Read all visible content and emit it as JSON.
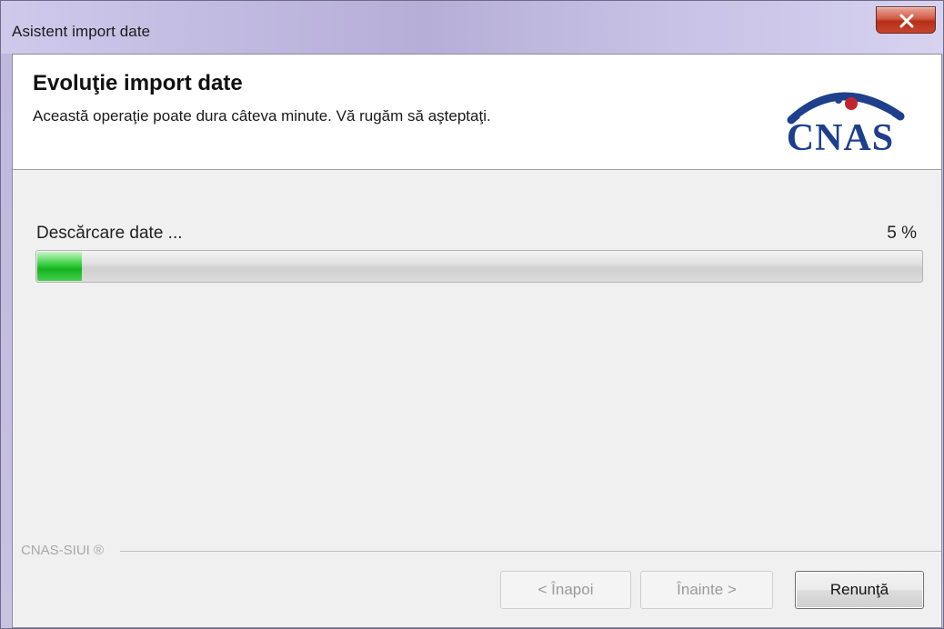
{
  "window": {
    "title": "Asistent import date"
  },
  "header": {
    "title": "Evoluţie import date",
    "subtitle": "Această operaţie poate dura câteva minute. Vă rugăm să aşteptaţi.",
    "logo_text": "CNAS"
  },
  "progress": {
    "label": "Descărcare date ...",
    "percent_label": "5 %",
    "value": 5
  },
  "footer": {
    "brand": "CNAS-SIUI ®"
  },
  "buttons": {
    "back": "< Înapoi",
    "next": "Înainte >",
    "cancel": "Renunţă"
  },
  "colors": {
    "logo_blue": "#1e3f8c",
    "progress_green": "#16b321",
    "close_red": "#c4452e"
  }
}
